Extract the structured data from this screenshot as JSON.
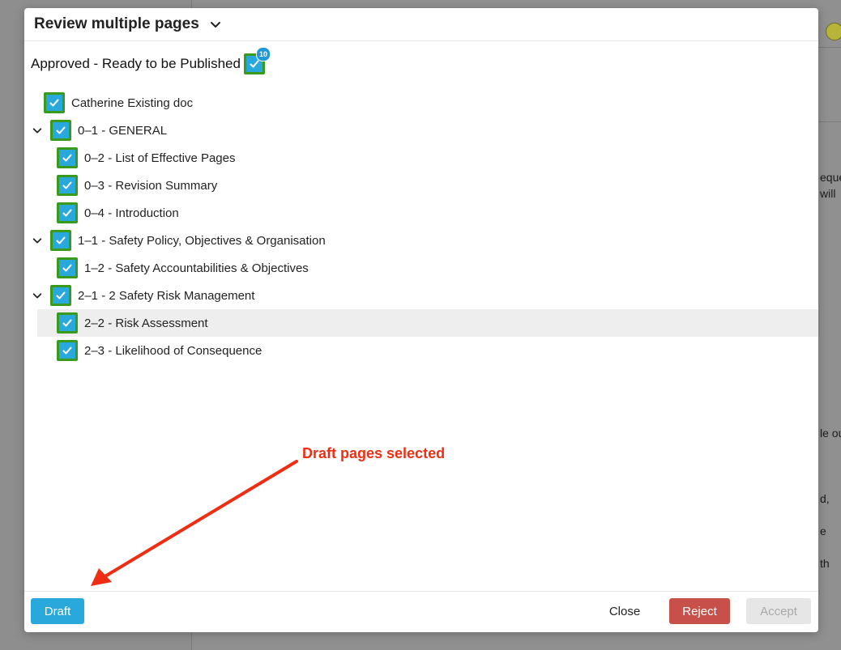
{
  "background": {
    "fragments": [
      "eque",
      "will",
      "le ou",
      "d,",
      "e",
      "th"
    ]
  },
  "modal": {
    "title": "Review multiple pages",
    "title_icon": "chevron-down-icon",
    "group": {
      "label": "Approved - Ready to be Published",
      "count": "10",
      "checked": true
    },
    "tree": [
      {
        "label": "Catherine Existing doc",
        "level": 0,
        "expandable": false,
        "checked": true,
        "selected": false
      },
      {
        "label": "0–1 - GENERAL",
        "level": 0,
        "expandable": true,
        "checked": true,
        "selected": false
      },
      {
        "label": "0–2 - List of Effective Pages",
        "level": 1,
        "expandable": false,
        "checked": true,
        "selected": false
      },
      {
        "label": "0–3 - Revision Summary",
        "level": 1,
        "expandable": false,
        "checked": true,
        "selected": false
      },
      {
        "label": "0–4 - Introduction",
        "level": 1,
        "expandable": false,
        "checked": true,
        "selected": false
      },
      {
        "label": "1–1 - Safety Policy, Objectives & Organisation",
        "level": 0,
        "expandable": true,
        "checked": true,
        "selected": false
      },
      {
        "label": "1–2 - Safety Accountabilities & Objectives",
        "level": 1,
        "expandable": false,
        "checked": true,
        "selected": false
      },
      {
        "label": "2–1 - 2 Safety Risk Management",
        "level": 0,
        "expandable": true,
        "checked": true,
        "selected": false
      },
      {
        "label": "2–2 - Risk Assessment",
        "level": 1,
        "expandable": false,
        "checked": true,
        "selected": true
      },
      {
        "label": "2–3 - Likelihood of Consequence",
        "level": 1,
        "expandable": false,
        "checked": true,
        "selected": false
      }
    ],
    "footer": {
      "draft_label": "Draft",
      "close_label": "Close",
      "reject_label": "Reject",
      "accept_label": "Accept"
    }
  },
  "annotation": {
    "text": "Draft pages selected",
    "color": "#ee2e12"
  },
  "colors": {
    "checkbox_fill": "#29a8dc",
    "checkbox_border": "#3a9a1c",
    "reject": "#c8504a",
    "draft": "#29a8dc"
  }
}
